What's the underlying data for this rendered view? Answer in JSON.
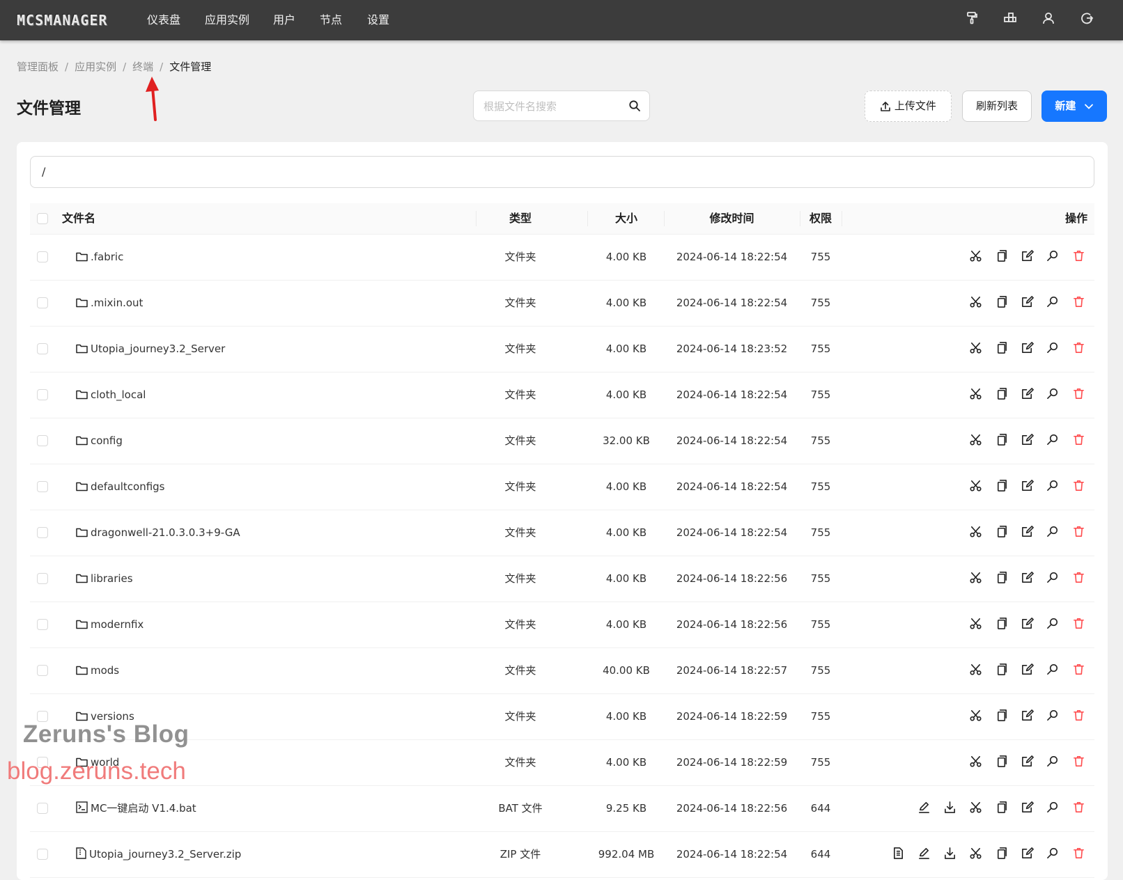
{
  "nav": {
    "logo": "MCSMANAGER",
    "items": [
      "仪表盘",
      "应用实例",
      "用户",
      "节点",
      "设置"
    ],
    "right_icons": [
      "paint-roller-icon",
      "blocks-icon",
      "user-icon",
      "logout-icon"
    ]
  },
  "breadcrumb": {
    "items": [
      "管理面板",
      "应用实例",
      "终端"
    ],
    "current": "文件管理"
  },
  "page": {
    "title": "文件管理",
    "search_placeholder": "根据文件名搜索",
    "upload_label": "上传文件",
    "refresh_label": "刷新列表",
    "new_label": "新建"
  },
  "path": "/",
  "table": {
    "headers": {
      "name": "文件名",
      "type": "类型",
      "size": "大小",
      "time": "修改时间",
      "perm": "权限",
      "actions": "操作"
    },
    "rows": [
      {
        "name": ".fabric",
        "type": "文件夹",
        "size": "4.00 KB",
        "time": "2024-06-14 18:22:54",
        "perm": "755",
        "icon": "folder-icon",
        "actions": [
          "cut",
          "copy",
          "edit",
          "search",
          "delete"
        ]
      },
      {
        "name": ".mixin.out",
        "type": "文件夹",
        "size": "4.00 KB",
        "time": "2024-06-14 18:22:54",
        "perm": "755",
        "icon": "folder-icon",
        "actions": [
          "cut",
          "copy",
          "edit",
          "search",
          "delete"
        ]
      },
      {
        "name": "Utopia_journey3.2_Server",
        "type": "文件夹",
        "size": "4.00 KB",
        "time": "2024-06-14 18:23:52",
        "perm": "755",
        "icon": "folder-icon",
        "actions": [
          "cut",
          "copy",
          "edit",
          "search",
          "delete"
        ]
      },
      {
        "name": "cloth_local",
        "type": "文件夹",
        "size": "4.00 KB",
        "time": "2024-06-14 18:22:54",
        "perm": "755",
        "icon": "folder-icon",
        "actions": [
          "cut",
          "copy",
          "edit",
          "search",
          "delete"
        ]
      },
      {
        "name": "config",
        "type": "文件夹",
        "size": "32.00 KB",
        "time": "2024-06-14 18:22:54",
        "perm": "755",
        "icon": "folder-icon",
        "actions": [
          "cut",
          "copy",
          "edit",
          "search",
          "delete"
        ]
      },
      {
        "name": "defaultconfigs",
        "type": "文件夹",
        "size": "4.00 KB",
        "time": "2024-06-14 18:22:54",
        "perm": "755",
        "icon": "folder-icon",
        "actions": [
          "cut",
          "copy",
          "edit",
          "search",
          "delete"
        ]
      },
      {
        "name": "dragonwell-21.0.3.0.3+9-GA",
        "type": "文件夹",
        "size": "4.00 KB",
        "time": "2024-06-14 18:22:54",
        "perm": "755",
        "icon": "folder-icon",
        "actions": [
          "cut",
          "copy",
          "edit",
          "search",
          "delete"
        ]
      },
      {
        "name": "libraries",
        "type": "文件夹",
        "size": "4.00 KB",
        "time": "2024-06-14 18:22:56",
        "perm": "755",
        "icon": "folder-icon",
        "actions": [
          "cut",
          "copy",
          "edit",
          "search",
          "delete"
        ]
      },
      {
        "name": "modernfix",
        "type": "文件夹",
        "size": "4.00 KB",
        "time": "2024-06-14 18:22:56",
        "perm": "755",
        "icon": "folder-icon",
        "actions": [
          "cut",
          "copy",
          "edit",
          "search",
          "delete"
        ]
      },
      {
        "name": "mods",
        "type": "文件夹",
        "size": "40.00 KB",
        "time": "2024-06-14 18:22:57",
        "perm": "755",
        "icon": "folder-icon",
        "actions": [
          "cut",
          "copy",
          "edit",
          "search",
          "delete"
        ]
      },
      {
        "name": "versions",
        "type": "文件夹",
        "size": "4.00 KB",
        "time": "2024-06-14 18:22:59",
        "perm": "755",
        "icon": "folder-icon",
        "actions": [
          "cut",
          "copy",
          "edit",
          "search",
          "delete"
        ]
      },
      {
        "name": "world",
        "type": "文件夹",
        "size": "4.00 KB",
        "time": "2024-06-14 18:22:59",
        "perm": "755",
        "icon": "folder-icon",
        "actions": [
          "cut",
          "copy",
          "edit",
          "search",
          "delete"
        ]
      },
      {
        "name": "MC一键启动 V1.4.bat",
        "type": "BAT 文件",
        "size": "9.25 KB",
        "time": "2024-06-14 18:22:56",
        "perm": "644",
        "icon": "terminal-file-icon",
        "actions": [
          "rename",
          "download",
          "cut",
          "copy",
          "edit",
          "search",
          "delete"
        ]
      },
      {
        "name": "Utopia_journey3.2_Server.zip",
        "type": "ZIP 文件",
        "size": "992.04 MB",
        "time": "2024-06-14 18:22:54",
        "perm": "644",
        "icon": "zip-file-icon",
        "actions": [
          "unzip",
          "rename",
          "download",
          "cut",
          "copy",
          "edit",
          "search",
          "delete"
        ]
      }
    ]
  },
  "watermark": {
    "line1": "Zeruns's Blog",
    "line2": "blog.zeruns.tech"
  },
  "colors": {
    "topbar": "#3c3c3c",
    "primary": "#1677ff",
    "danger": "#ff4d4f",
    "annotation_arrow": "#e02020"
  }
}
